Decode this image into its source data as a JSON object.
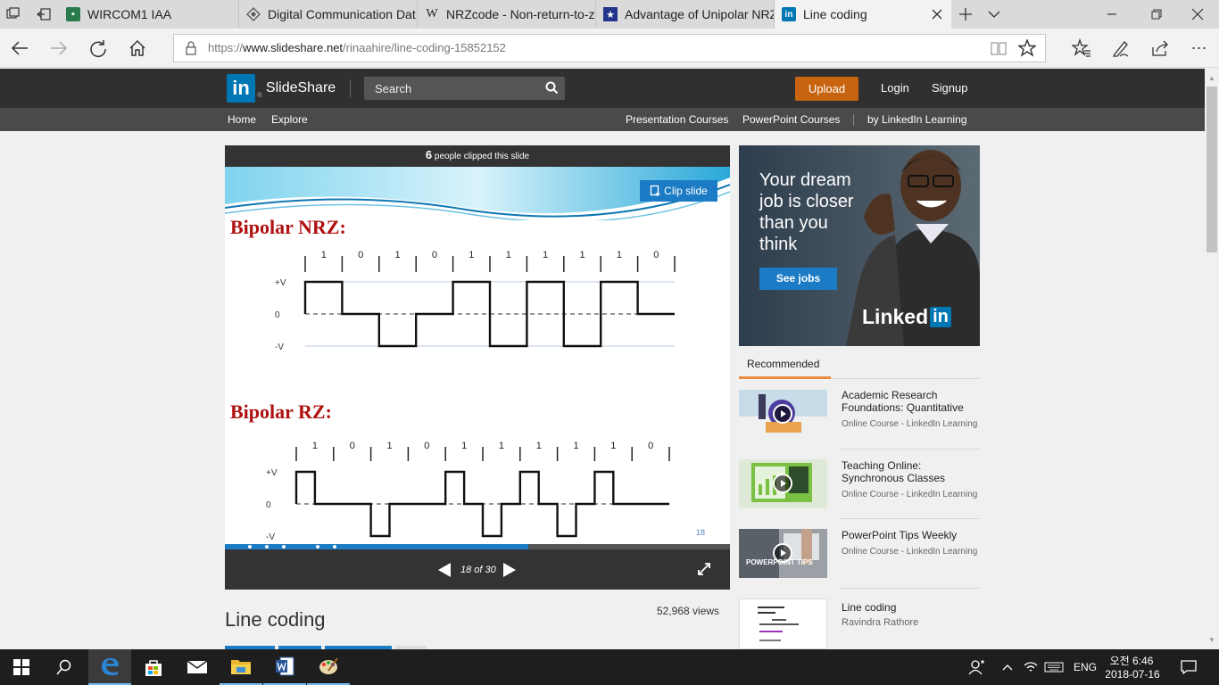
{
  "browser": {
    "tabs": [
      {
        "title": "WIRCOM1 IAA",
        "icon": "teams-icon"
      },
      {
        "title": "Digital Communication Dat",
        "icon": "diamond-icon"
      },
      {
        "title": "NRZcode - Non-return-to-z",
        "icon": "wikipedia-icon"
      },
      {
        "title": "Advantage of Unipolar NRZ",
        "icon": "star-badge-icon"
      },
      {
        "title": "Line coding",
        "icon": "linkedin-icon"
      }
    ],
    "url_prefix": "https://",
    "url_domain": "www.slideshare.net",
    "url_path": "/rinaahire/line-coding-15852152"
  },
  "site": {
    "logo_in": "in",
    "logo_text": "SlideShare",
    "search_placeholder": "Search",
    "upload_label": "Upload",
    "login_label": "Login",
    "signup_label": "Signup",
    "subnav_left": [
      "Home",
      "Explore"
    ],
    "subnav_right": [
      "Presentation Courses",
      "PowerPoint Courses",
      "by LinkedIn Learning"
    ]
  },
  "player": {
    "clipped_count": "6",
    "clipped_text": "people clipped this slide",
    "clip_button": "Clip slide",
    "page_indicator": "18 of 30",
    "progress": 0.6,
    "slide_number": "18"
  },
  "slide": {
    "nrz_title": "Bipolar NRZ:",
    "rz_title": "Bipolar RZ:",
    "bits": [
      "1",
      "0",
      "1",
      "0",
      "1",
      "1",
      "1",
      "1",
      "1",
      "0"
    ],
    "levels": [
      "+V",
      "0",
      "-V"
    ]
  },
  "presentation": {
    "title": "Line coding",
    "views": "52,968 views"
  },
  "ad": {
    "headline_lines": [
      "Your dream",
      "job is closer",
      "than you",
      "think"
    ],
    "cta": "See jobs",
    "brand": "Linked",
    "brand_in": "in"
  },
  "recommended": {
    "header": "Recommended",
    "items": [
      {
        "title": "Academic Research Foundations: Quantitative",
        "sub": "Online Course - LinkedIn Learning"
      },
      {
        "title": "Teaching Online: Synchronous Classes",
        "sub": "Online Course - LinkedIn Learning"
      },
      {
        "title": "PowerPoint Tips Weekly",
        "sub": "Online Course - LinkedIn Learning",
        "thumb_text": "POWERPOINT TIPS"
      },
      {
        "title": "Line coding",
        "sub": "Ravindra Rathore"
      }
    ]
  },
  "taskbar": {
    "lang": "ENG",
    "time": "오전 6:46",
    "date": "2018-07-16"
  },
  "colors": {
    "accent_blue": "#1b7bc4",
    "upload_orange": "#c8640f",
    "slide_title_red": "#b01010",
    "linkedin_blue": "#0077b5"
  }
}
